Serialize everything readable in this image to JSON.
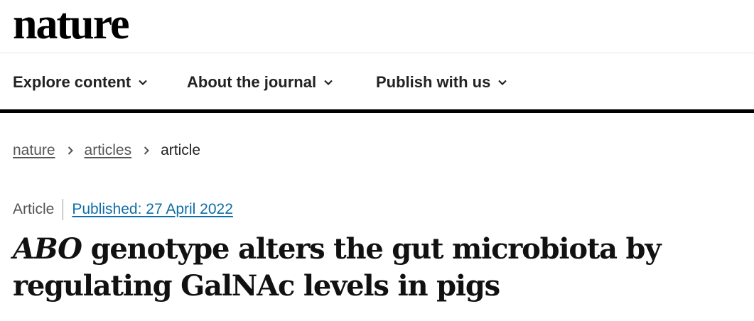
{
  "brand": {
    "logo_text": "nature"
  },
  "nav": {
    "items": [
      {
        "label": "Explore content",
        "icon": "chevron-down-icon"
      },
      {
        "label": "About the journal",
        "icon": "chevron-down-icon"
      },
      {
        "label": "Publish with us",
        "icon": "chevron-down-icon"
      }
    ]
  },
  "breadcrumb": {
    "items": [
      {
        "label": "nature"
      },
      {
        "label": "articles"
      },
      {
        "label": "article"
      }
    ],
    "separator_icon": "chevron-right-icon"
  },
  "article": {
    "type": "Article",
    "published_label": "Published:",
    "published_date": "27 April 2022",
    "title_gene": "ABO",
    "title_rest": " genotype alters the gut microbiota by regulating GalNAc levels in pigs"
  },
  "colors": {
    "link_blue": "#0c6ea6",
    "text_dark": "#222222",
    "text_muted": "#555555",
    "rule_black": "#000000"
  }
}
